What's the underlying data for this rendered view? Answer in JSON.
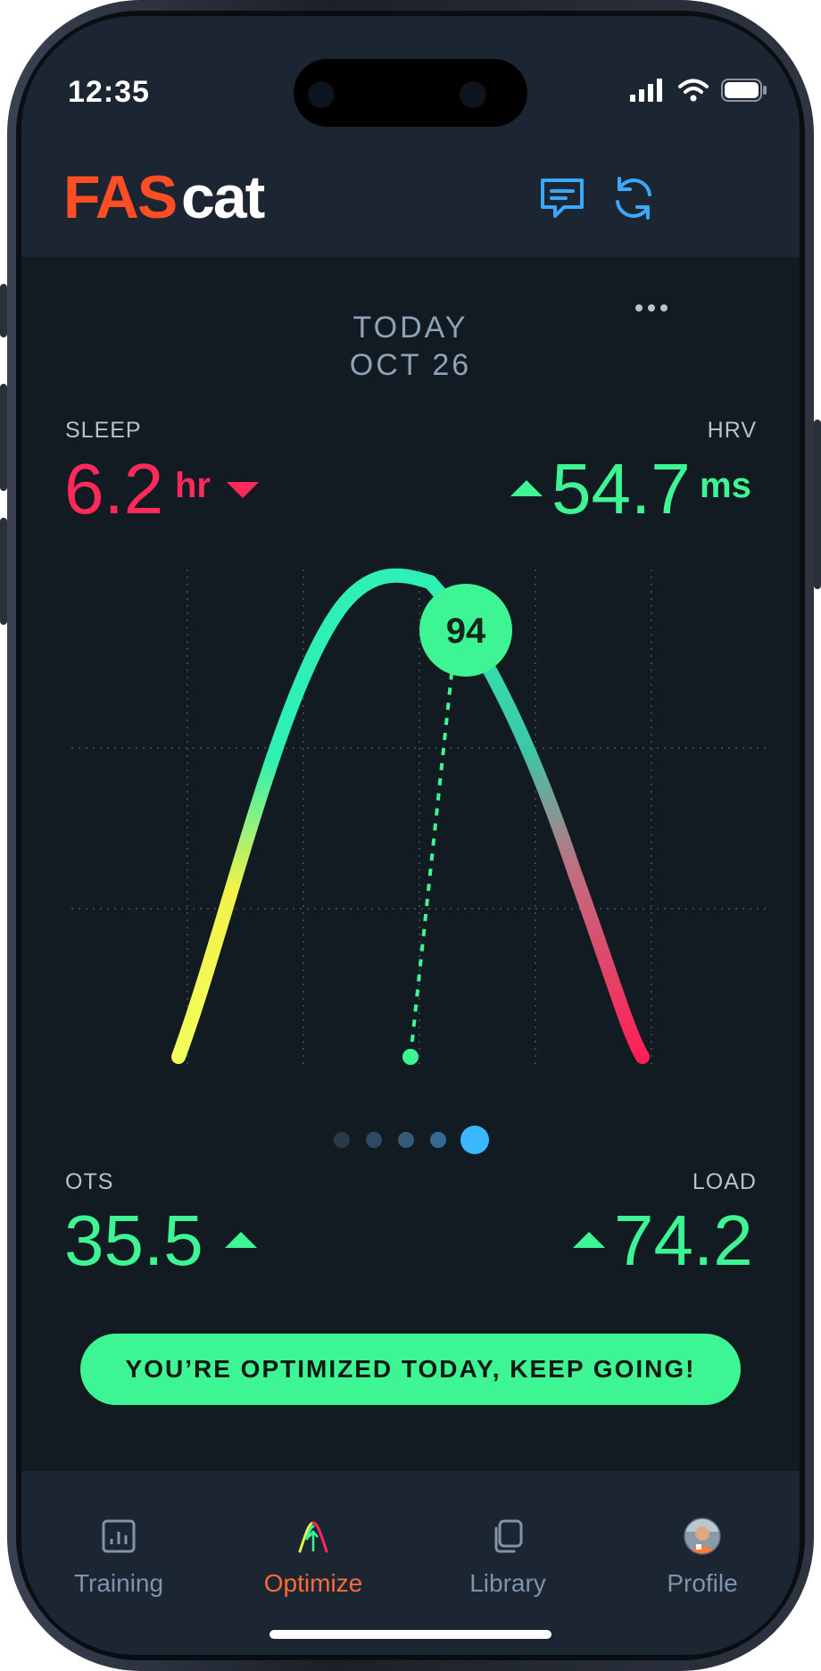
{
  "status_bar": {
    "time": "12:35"
  },
  "header": {
    "logo_part1": "FAS",
    "logo_part2": "cat",
    "icons": [
      "chat-icon",
      "refresh-icon"
    ]
  },
  "date": {
    "line1": "TODAY",
    "line2": "OCT 26"
  },
  "metrics": {
    "sleep": {
      "label": "SLEEP",
      "value": "6.2",
      "unit": "hr",
      "trend": "down",
      "color": "#ff2a5a"
    },
    "hrv": {
      "label": "HRV",
      "value": "54.7",
      "unit": "ms",
      "trend": "up",
      "color": "#3ef594"
    },
    "ots": {
      "label": "OTS",
      "value": "35.5",
      "trend": "up",
      "color": "#3ef594"
    },
    "load": {
      "label": "LOAD",
      "value": "74.2",
      "trend": "up",
      "color": "#3ef594"
    }
  },
  "gauge": {
    "score": "94",
    "score_fraction": 0.94
  },
  "pager": {
    "count": 5,
    "active_index": 4
  },
  "cta": {
    "label": "YOU’RE OPTIMIZED TODAY, KEEP GOING!"
  },
  "tabs": [
    {
      "label": "Training",
      "icon": "chart-icon",
      "active": false
    },
    {
      "label": "Optimize",
      "icon": "optimize-curve-icon",
      "active": true
    },
    {
      "label": "Library",
      "icon": "library-icon",
      "active": false
    },
    {
      "label": "Profile",
      "icon": "avatar",
      "active": false
    }
  ],
  "colors": {
    "accent_green": "#3ef594",
    "alert_red": "#ff2a5a",
    "active_tab": "#ff6a3a",
    "background": "#121a22"
  }
}
